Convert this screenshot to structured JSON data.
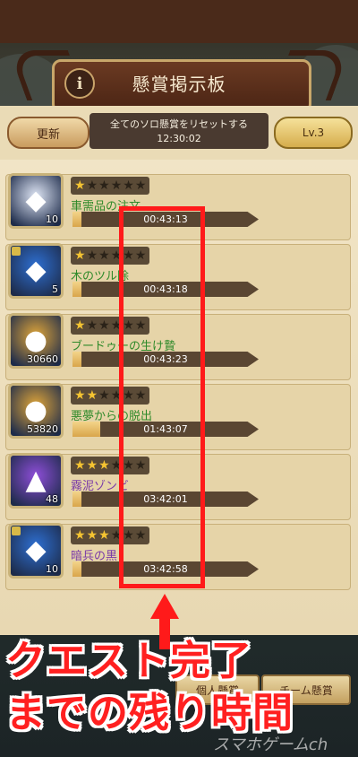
{
  "header": {
    "title": "懸賞掲示板",
    "info_icon": "i",
    "update_button": "更新",
    "reset_line1": "全てのソロ懸賞をリセットする",
    "reset_line2": "12:30:02",
    "level_button": "Lv.3"
  },
  "quests": [
    {
      "icon": "diamond-icon",
      "glyph": "◆",
      "icon_color": "#dfe6f5",
      "count": "10",
      "stars": 1,
      "name": "車需品の注文",
      "time": "00:43:13",
      "progress": 0.05,
      "name_color": "green"
    },
    {
      "icon": "crystal-icon",
      "glyph": "◆",
      "icon_color": "#2e6fd1",
      "count": "5",
      "stars": 1,
      "name": "木のツル除",
      "time": "00:43:18",
      "progress": 0.05,
      "name_color": "green",
      "puzzle": true
    },
    {
      "icon": "gold-coin-icon",
      "glyph": "●",
      "icon_color": "#e0a63a",
      "count": "30660",
      "stars": 1,
      "name": "ブードゥーの生け贄",
      "time": "00:43:23",
      "progress": 0.05,
      "name_color": "green"
    },
    {
      "icon": "gold-coin-icon",
      "glyph": "●",
      "icon_color": "#e0a63a",
      "count": "53820",
      "stars": 2,
      "name": "悪夢からの脱出",
      "time": "01:43:07",
      "progress": 0.15,
      "name_color": "green"
    },
    {
      "icon": "purple-crystal-icon",
      "glyph": "▲",
      "icon_color": "#8e4ed8",
      "count": "48",
      "stars": 3,
      "name": "霧泥ゾンビ",
      "time": "03:42:01",
      "progress": 0.05,
      "name_color": "purple"
    },
    {
      "icon": "crystal-icon",
      "glyph": "◆",
      "icon_color": "#2e6fd1",
      "count": "10",
      "stars": 3,
      "name": "暗兵の黒",
      "time": "03:42:58",
      "progress": 0.05,
      "name_color": "purple",
      "puzzle": true
    }
  ],
  "tabs": {
    "personal": "個人懸賞",
    "team": "チーム懸賞"
  },
  "overlay": {
    "line1": "クエスト完了",
    "line2": "までの残り時間",
    "watermark": "スマホゲームch"
  },
  "colors": {
    "highlight": "#ff1a1a",
    "overlay_text": "#ff2020"
  }
}
